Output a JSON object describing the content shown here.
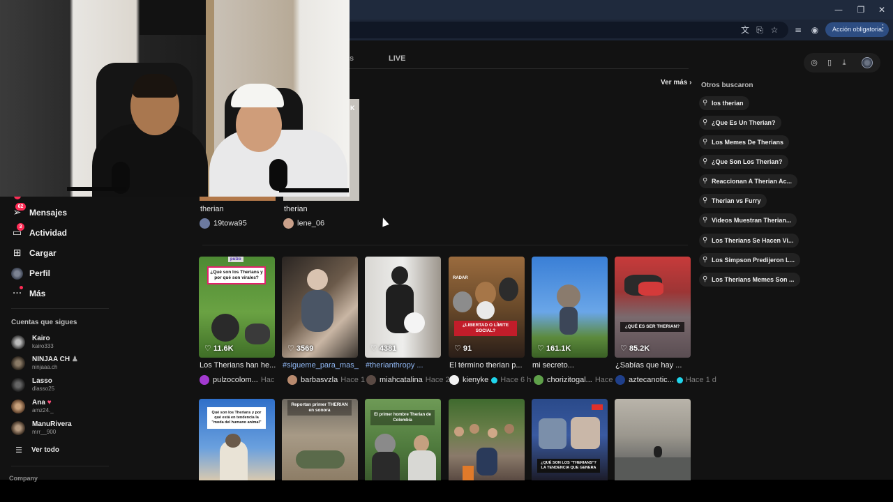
{
  "browser": {
    "translate_icon": "translate-icon",
    "cast_icon": "install-icon",
    "bookmark_icon": "star-icon",
    "media_icon": "media-control-icon",
    "profile_icon": "profile-icon",
    "action_required_label": "Acción obligatoria",
    "window": {
      "minimize": "—",
      "restore": "❐",
      "close": "✕"
    }
  },
  "search": {
    "tabs": [
      {
        "label": "s"
      },
      {
        "label": "LIVE"
      }
    ],
    "see_more": "Ver más ›",
    "top_row": [
      {
        "caption": "therian",
        "username": "19towa95"
      },
      {
        "caption": "therian",
        "username": "lene_06"
      }
    ],
    "peek_letter": "K"
  },
  "sidebar": {
    "items": [
      {
        "label": "Mensajes",
        "icon": "messages-icon",
        "badge": "62"
      },
      {
        "label": "Actividad",
        "icon": "activity-icon",
        "badge": "3"
      },
      {
        "label": "Cargar",
        "icon": "upload-icon"
      },
      {
        "label": "Perfil",
        "icon": "profile-avatar"
      },
      {
        "label": "Más",
        "icon": "more-icon"
      }
    ],
    "following_title": "Cuentas que sigues",
    "following": [
      {
        "name": "Kairo",
        "handle": "kairo333"
      },
      {
        "name": "NINJAA CH",
        "handle": "ninjaaa.ch"
      },
      {
        "name": "Lasso",
        "handle": "dlasso25"
      },
      {
        "name": "Ana",
        "handle": "amz24._"
      },
      {
        "name": "ManuRivera",
        "handle": "mrr__900"
      }
    ],
    "see_all": "Ver todo",
    "company": "Company"
  },
  "suggestions": {
    "title": "Otros buscaron",
    "items": [
      "los therian",
      "¿Que Es Un Therian?",
      "Los Memes De Therians",
      "¿Que Son Los Therian?",
      "Reaccionan A Therian Ac...",
      "Therian vs Furry",
      "Videos Muestran Therian...",
      "Los Therians Se Hacen Vi...",
      "Los Simpson Predijeron L...",
      "Los Therians Memes Son ..."
    ]
  },
  "videos_row1": [
    {
      "likes": "11.6K",
      "caption": "Los Therians han he...",
      "user": "pulzocolom...",
      "time": "Hac",
      "overlay": "¿Qué son los Therians y por qué son virales?",
      "brand": "pulzo"
    },
    {
      "likes": "3569",
      "caption": "#sigueme_para_mas_",
      "user": "barbasvzla",
      "time": "Hace 1 d"
    },
    {
      "likes": "4381",
      "caption": "#therianthropy ...",
      "user": "miahcatalina",
      "time": "Hace 2"
    },
    {
      "likes": "91",
      "caption": "El término therian p...",
      "user": "kienyke",
      "time": "Hace 6 h",
      "overlay": "¿LIBERTAD O LÍMITE SOCIAL?",
      "radar": "RADAR"
    },
    {
      "likes": "161.1K",
      "caption": "mi secreto...",
      "user": "chorizitogal...",
      "time": "Hace"
    },
    {
      "likes": "85.2K",
      "caption": "¿Sabías que hay ...",
      "user": "aztecanotic...",
      "time": "Hace 1 d",
      "overlay": "¿QUÉ ES SER THERIAN?"
    }
  ],
  "videos_row2": [
    {
      "overlay": "Qué son los Therians y por qué está en tendencia la \"moda del humano animal\""
    },
    {
      "overlay": "Reportan primer THERIAN en sonora"
    },
    {
      "overlay": "El primer hombre Therian de Colombia"
    },
    {},
    {
      "overlay": "¿QUÉ SON LOS \"THERIANS\"? LA TENDENCIA QUE GENERA"
    },
    {}
  ]
}
